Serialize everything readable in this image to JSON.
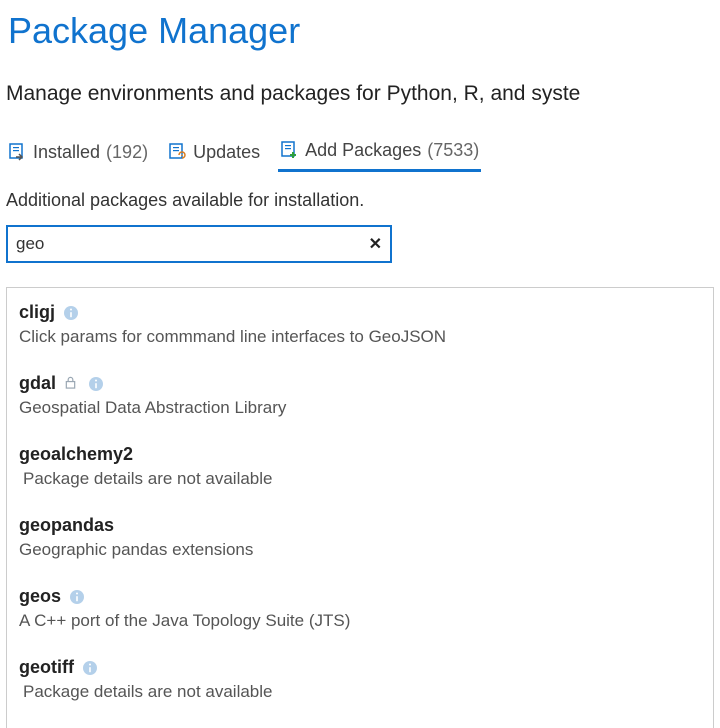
{
  "title": "Package Manager",
  "subtitle": "Manage environments and packages for Python, R, and syste",
  "tabs": {
    "installed": {
      "label": "Installed",
      "count": "(192)"
    },
    "updates": {
      "label": "Updates"
    },
    "add": {
      "label": "Add Packages",
      "count": "(7533)"
    }
  },
  "add_section": {
    "description": "Additional packages available for installation.",
    "search_value": "geo",
    "missing_details_label": "Package details are not available",
    "clear_label": "✕"
  },
  "results": [
    {
      "name": "cligj",
      "desc": "Click params for commmand line interfaces to GeoJSON",
      "info": true,
      "lock": false
    },
    {
      "name": "gdal",
      "desc": "Geospatial Data Abstraction Library",
      "info": true,
      "lock": true
    },
    {
      "name": "geoalchemy2",
      "desc": null,
      "info": false,
      "lock": false
    },
    {
      "name": "geopandas",
      "desc": "Geographic pandas extensions",
      "info": false,
      "lock": false
    },
    {
      "name": "geos",
      "desc": "A C++ port of the Java Topology Suite (JTS)",
      "info": true,
      "lock": false
    },
    {
      "name": "geotiff",
      "desc": null,
      "info": true,
      "lock": false
    }
  ]
}
